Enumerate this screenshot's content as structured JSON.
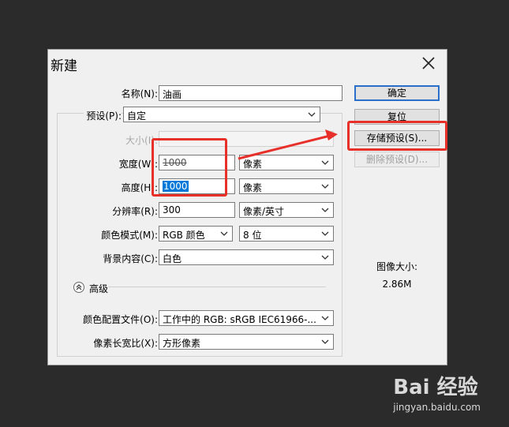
{
  "dialog": {
    "title": "新建",
    "name_label": "名称(N):",
    "name_value": "油画",
    "preset_label": "预设(P):",
    "preset_value": "自定",
    "size_label": "大小(I):",
    "width_label": "宽度(W):",
    "width_value": "1000",
    "width_unit": "像素",
    "height_label": "高度(H):",
    "height_value": "1000",
    "height_unit": "像素",
    "resolution_label": "分辨率(R):",
    "resolution_value": "300",
    "resolution_unit": "像素/英寸",
    "color_mode_label": "颜色模式(M):",
    "color_mode_value": "RGB 颜色",
    "bit_depth_value": "8 位",
    "background_label": "背景内容(C):",
    "background_value": "白色",
    "advanced_label": "高级",
    "color_profile_label": "颜色配置文件(O):",
    "color_profile_value": "工作中的 RGB: sRGB IEC61966-...",
    "pixel_aspect_label": "像素长宽比(X):",
    "pixel_aspect_value": "方形像素",
    "ok_button": "确定",
    "reset_button": "复位",
    "save_preset_button": "存储预设(S)...",
    "delete_preset_button": "删除预设(D)...",
    "image_size_label": "图像大小:",
    "image_size_value": "2.86M"
  },
  "watermark": {
    "brand": "Bai 经验",
    "url": "jingyan.baidu.com"
  },
  "colors": {
    "annotation": "#e8302a",
    "selection": "#0078d7",
    "default_button_border": "#2a6fc9"
  }
}
